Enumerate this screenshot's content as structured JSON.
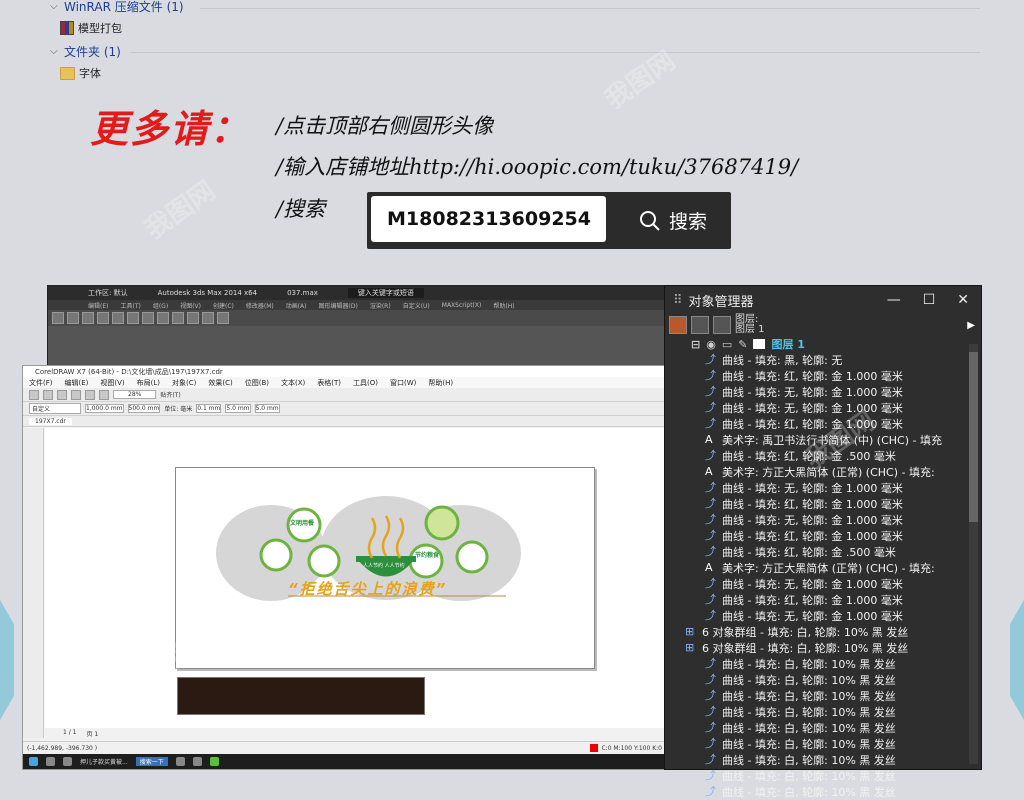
{
  "explorer": {
    "group1_label": "WinRAR 压缩文件 (1)",
    "group1_file": "模型打包",
    "group2_label": "文件夹 (1)",
    "group2_file": "字体"
  },
  "promo": {
    "headline": "更多请：",
    "line1": "/点击顶部右侧圆形头像",
    "line2": "/输入店铺地址http://hi.ooopic.com/tuku/37687419/",
    "line3": "/搜索",
    "search_value": "M18082313609254",
    "search_button": "搜索"
  },
  "max_window": {
    "title": "Autodesk 3ds Max  2014 x64",
    "file": "037.max",
    "workspace": "工作区: 默认",
    "menu": [
      "编辑(E)",
      "工具(T)",
      "组(G)",
      "视图(V)",
      "创建(C)",
      "修改器(M)",
      "动画(A)",
      "图形编辑器(D)",
      "渲染(R)",
      "自定义(U)",
      "MAXScript(X)",
      "帮助(H)"
    ],
    "search_placeholder": "键入关键字或短语"
  },
  "corel_window": {
    "title": "CorelDRAW X7 (64-Bit) - D:\\文化墙\\成品\\197\\197X7.cdr",
    "menu": [
      "文件(F)",
      "编辑(E)",
      "视图(V)",
      "布局(L)",
      "对象(C)",
      "效果(C)",
      "位图(B)",
      "文本(X)",
      "表格(T)",
      "工具(O)",
      "窗口(W)",
      "帮助(H)"
    ],
    "preset": "自定义",
    "width": "1,000.0 mm",
    "height": "500.0 mm",
    "units": "单位: 毫米",
    "nudge": "0.1 mm",
    "dup1": "5.0 mm",
    "dup2": "5.0 mm",
    "zoom": "28%",
    "snap": "贴齐(T)",
    "tab": "197X7.cdr",
    "page_counter": "1 / 1",
    "page_tab": "页 1",
    "coords": "(-1,462.989, -396.730 )",
    "status_fill": "C:0 M:100 Y:100 K:0",
    "slogan": "“拒绝舌尖上的浪费”",
    "art_labels": [
      "文明用餐",
      "节约粮食",
      "人人节约 人人节约"
    ],
    "taskbar_item1": "押儿子款买黄被...",
    "taskbar_item2": "搜索一下"
  },
  "object_manager": {
    "title": "对象管理器",
    "header_rows": [
      "图层:",
      "图层 1"
    ],
    "layer_name": "图层 1",
    "rows": [
      {
        "icon": "curve",
        "text": "曲线 - 填充: 黑, 轮廓: 无"
      },
      {
        "icon": "curve",
        "text": "曲线 - 填充: 红, 轮廓: 金  1.000 毫米"
      },
      {
        "icon": "curve",
        "text": "曲线 - 填充: 无, 轮廓: 金  1.000 毫米"
      },
      {
        "icon": "curve",
        "text": "曲线 - 填充: 无, 轮廓: 金  1.000 毫米"
      },
      {
        "icon": "curve",
        "text": "曲线 - 填充: 红, 轮廓: 金  1.000 毫米"
      },
      {
        "icon": "text",
        "text": "美术字: 禹卫书法行书简体 (中) (CHC) - 填充"
      },
      {
        "icon": "curve",
        "text": "曲线 - 填充: 红, 轮廓: 金  .500 毫米"
      },
      {
        "icon": "text",
        "text": "美术字: 方正大黑简体 (正常) (CHC) - 填充:"
      },
      {
        "icon": "curve",
        "text": "曲线 - 填充: 无, 轮廓: 金  1.000 毫米"
      },
      {
        "icon": "curve",
        "text": "曲线 - 填充: 红, 轮廓: 金  1.000 毫米"
      },
      {
        "icon": "curve",
        "text": "曲线 - 填充: 无, 轮廓: 金  1.000 毫米"
      },
      {
        "icon": "curve",
        "text": "曲线 - 填充: 红, 轮廓: 金  1.000 毫米"
      },
      {
        "icon": "curve",
        "text": "曲线 - 填充: 红, 轮廓: 金  .500 毫米"
      },
      {
        "icon": "text",
        "text": "美术字: 方正大黑简体 (正常) (CHC) - 填充:"
      },
      {
        "icon": "curve",
        "text": "曲线 - 填充: 无, 轮廓: 金  1.000 毫米"
      },
      {
        "icon": "curve",
        "text": "曲线 - 填充: 红, 轮廓: 金  1.000 毫米"
      },
      {
        "icon": "curve",
        "text": "曲线 - 填充: 无, 轮廓: 金  1.000 毫米"
      },
      {
        "icon": "group",
        "text": "6 对象群组 - 填充: 白, 轮廓: 10% 黑 发丝"
      },
      {
        "icon": "group",
        "text": "6 对象群组 - 填充: 白, 轮廓: 10% 黑 发丝"
      },
      {
        "icon": "curve",
        "text": "曲线 - 填充: 白, 轮廓: 10% 黑 发丝"
      },
      {
        "icon": "curve",
        "text": "曲线 - 填充: 白, 轮廓: 10% 黑 发丝"
      },
      {
        "icon": "curve",
        "text": "曲线 - 填充: 白, 轮廓: 10% 黑 发丝"
      },
      {
        "icon": "curve",
        "text": "曲线 - 填充: 白, 轮廓: 10% 黑 发丝"
      },
      {
        "icon": "curve",
        "text": "曲线 - 填充: 白, 轮廓: 10% 黑 发丝"
      },
      {
        "icon": "curve",
        "text": "曲线 - 填充: 白, 轮廓: 10% 黑 发丝"
      },
      {
        "icon": "curve",
        "text": "曲线 - 填充: 白, 轮廓: 10% 黑 发丝"
      },
      {
        "icon": "curve",
        "text": "曲线 - 填充: 白, 轮廓: 10% 黑 发丝"
      },
      {
        "icon": "curve",
        "text": "曲线 - 填充: 白, 轮廓: 10% 黑 发丝"
      }
    ]
  },
  "watermark": "我图网",
  "colors": {
    "accent_red": "#e21a1a",
    "slogan_orange": "#e6a31a",
    "layer_blue": "#4fc3e8",
    "green": "#6db33f"
  }
}
